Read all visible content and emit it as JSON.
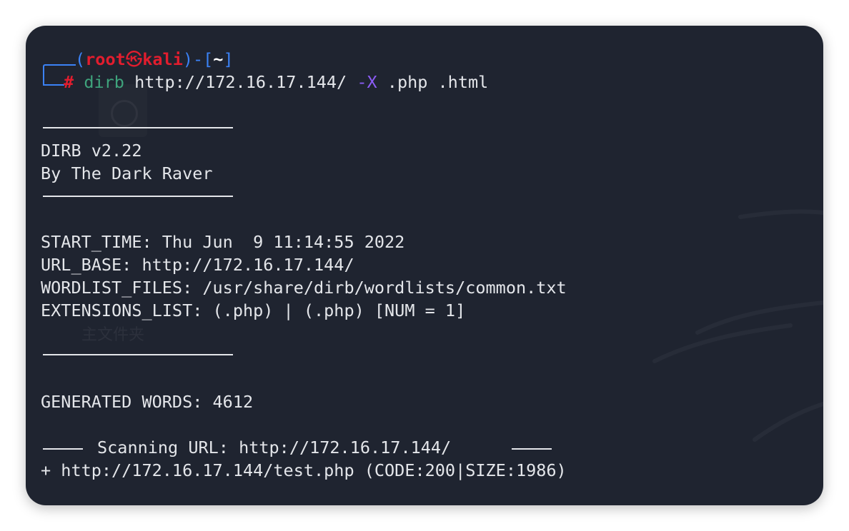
{
  "prompt": {
    "open": "(",
    "user": "root",
    "at": "㉿",
    "host": "kali",
    "sep": ")-[",
    "dir": "~",
    "close": "]",
    "hash": "#",
    "cmd": "dirb",
    "args1": "http://172.16.17.144/",
    "flag": "-X",
    "args2": ".php .html"
  },
  "banner": {
    "version": "DIRB v2.22",
    "author": "By The Dark Raver"
  },
  "info": {
    "start_time": "START_TIME: Thu Jun  9 11:14:55 2022",
    "url_base": "URL_BASE: http://172.16.17.144/",
    "wordlist": "WORDLIST_FILES: /usr/share/dirb/wordlists/common.txt",
    "extensions": "EXTENSIONS_LIST: (.php) | (.php) [NUM = 1]"
  },
  "generated": "GENERATED WORDS: 4612",
  "scanning": "Scanning URL: http://172.16.17.144/",
  "result": "+ http://172.16.17.144/test.php (CODE:200|SIZE:1986)",
  "watermark": "主文件夹",
  "colors": {
    "background": "#1f2430",
    "text": "#e4e6ea",
    "prompt_blue": "#3b82f6",
    "root_red": "#e11d2e",
    "command_green": "#3fa37c",
    "flag_purple": "#8b5cf6"
  }
}
